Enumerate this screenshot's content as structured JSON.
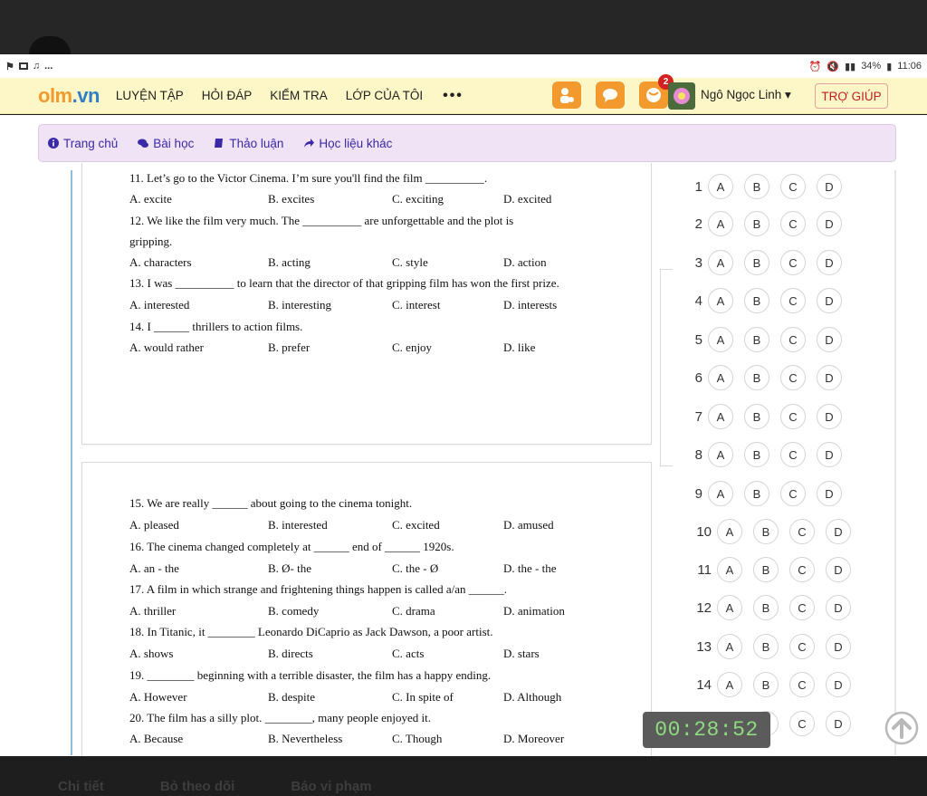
{
  "status_bar": {
    "left_icons": [
      "flag-icon",
      "screen-icon",
      "tiktok-icon"
    ],
    "left_more": "...",
    "battery": "34%",
    "time": "11:06"
  },
  "nav": {
    "logo_main": "olm",
    "logo_suffix": ".vn",
    "menu": [
      "LUYỆN TẬP",
      "HỎI ĐÁP",
      "KIỂM TRA",
      "LỚP CỦA TÔI"
    ],
    "more": "•••",
    "notification_count": "2",
    "user_name": "Ngô Ngọc Linh ▾",
    "help": "TRỢ GIÚP"
  },
  "subtabs": [
    "Trang chủ",
    "Bài học",
    "Thảo luận",
    "Học liệu khác"
  ],
  "questions_page1": [
    {
      "text": "11. Let’s go to the Victor Cinema. I’m sure you'll find the film __________.",
      "options": [
        "A. excite",
        "B. excites",
        "C. exciting",
        "D. excited"
      ]
    },
    {
      "text": "12. We like the film very much. The __________ are unforgettable and the plot is",
      "text2": "gripping.",
      "options": [
        "A. characters",
        "B. acting",
        "C. style",
        "D. action"
      ]
    },
    {
      "text": "13. I was __________ to learn that the director of that gripping film has won the first prize.",
      "options": [
        "A. interested",
        "B. interesting",
        "C. interest",
        "D. interests"
      ]
    },
    {
      "text": "14. I ______ thrillers to action films.",
      "options": [
        "A. would rather",
        "B. prefer",
        "C. enjoy",
        "D. like"
      ]
    }
  ],
  "questions_page2": [
    {
      "text": "15. We are really ______ about going to the cinema tonight.",
      "options": [
        "A. pleased",
        "B. interested",
        "C. excited",
        "D. amused"
      ]
    },
    {
      "text": "16. The cinema changed completely at ______ end of ______ 1920s.",
      "options": [
        "A. an - the",
        "B. Ø- the",
        "C. the - Ø",
        "D. the - the"
      ]
    },
    {
      "text": "17. A film in which strange and frightening things happen is called a/an ______.",
      "options": [
        "A. thriller",
        "B. comedy",
        "C. drama",
        "D. animation"
      ]
    },
    {
      "text": "18. In Titanic, it ________ Leonardo DiCaprio as Jack Dawson, a poor artist.",
      "options": [
        "A. shows",
        "B. directs",
        "C. acts",
        "D. stars"
      ]
    },
    {
      "text": "19. ________ beginning with a terrible disaster, the film has a happy ending.",
      "options": [
        "A. However",
        "B. despite",
        "C. In spite of",
        "D. Although"
      ]
    },
    {
      "text": "20. The film has a silly plot. ________, many people enjoyed it.",
      "options": [
        "A. Because",
        "B. Nevertheless",
        "C. Though",
        "D. Moreover"
      ]
    }
  ],
  "answer_sheet": {
    "choices": [
      "A",
      "B",
      "C",
      "D"
    ],
    "numbers": [
      "1",
      "2",
      "3",
      "4",
      "5",
      "6",
      "7",
      "8",
      "9",
      "10",
      "11",
      "12",
      "13",
      "14"
    ],
    "partial_row_choices": [
      "B",
      "C",
      "D"
    ]
  },
  "timer": "00:28:52",
  "bottom_tabs": [
    "Chi tiết",
    "Bỏ theo dõi",
    "Báo vi phạm"
  ]
}
